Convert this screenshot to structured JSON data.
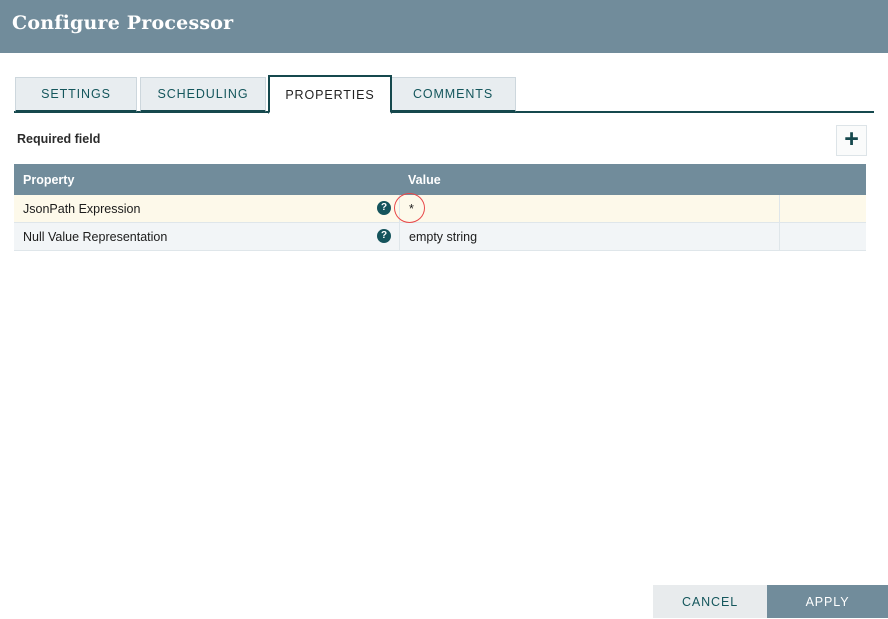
{
  "dialog": {
    "title": "Configure Processor"
  },
  "tabs": [
    {
      "label": "SETTINGS",
      "active": false
    },
    {
      "label": "SCHEDULING",
      "active": false
    },
    {
      "label": "PROPERTIES",
      "active": true
    },
    {
      "label": "COMMENTS",
      "active": false
    }
  ],
  "toolbar": {
    "required_field_note": "Required field",
    "add_property_glyph": "+",
    "add_property_icon": "plus-icon"
  },
  "table": {
    "columns": [
      {
        "key": "property",
        "label": "Property"
      },
      {
        "key": "value",
        "label": "Value"
      }
    ],
    "help_glyph": "?",
    "help_icon": "question-mark-icon",
    "rows": [
      {
        "property": "JsonPath Expression",
        "value": "*",
        "required": true,
        "highlighted": true
      },
      {
        "property": "Null Value Representation",
        "value": "empty string",
        "required": false,
        "highlighted": false
      }
    ]
  },
  "annotation": {
    "shape": "ellipse",
    "color": "#e8484a",
    "targets": "JsonPath Expression value"
  },
  "footer": {
    "cancel_label": "CANCEL",
    "apply_label": "APPLY"
  },
  "colors": {
    "header_bar": "#718c9b",
    "tab_border_active": "#15484d",
    "tab_inactive_bg": "#e8edf0",
    "tab_text": "#14565c",
    "row_required_bg": "#fdf9ea",
    "row_plain_bg": "#f2f5f7",
    "help_icon": "#15545c",
    "annotation": "#e8484a",
    "apply_bg": "#718c9b",
    "cancel_bg": "#e8ebed"
  }
}
